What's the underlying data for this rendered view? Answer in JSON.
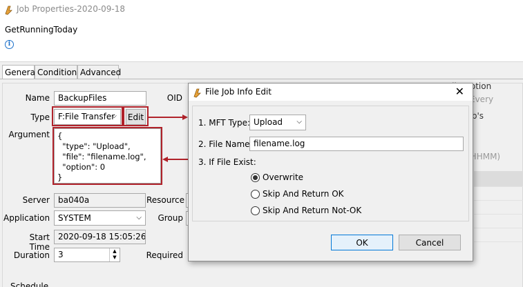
{
  "window": {
    "title": "Job Properties-2020-09-18",
    "job_name": "GetRunningToday",
    "info_icon": "info-icon"
  },
  "tabs": [
    {
      "label": "General",
      "active": true
    },
    {
      "label": "Condition",
      "active": false
    },
    {
      "label": "Advanced",
      "active": false
    }
  ],
  "form": {
    "name_label": "Name",
    "name_value": "BackupFiles",
    "oid_label": "OID",
    "type_label": "Type",
    "type_value": "F:File Transfer",
    "edit_button": "Edit",
    "argument_label": "Argument",
    "argument_value": "{\n  \"type\": \"Upload\",\n  \"file\": \"filename.log\",\n  \"option\": 0\n}",
    "server_label": "Server",
    "server_value": "ba040a",
    "resource_label": "Resource",
    "application_label": "Application",
    "application_value": "SYSTEM",
    "group_label": "Group",
    "start_time_label": "Start Time",
    "start_time_value": "2020-09-18 15:05:26",
    "duration_label": "Duration",
    "duration_value": "3",
    "required_label": "Required",
    "schedule_label": "Schedule"
  },
  "right_panel": {
    "option_label": "Cyclic Option",
    "every_label": "Every",
    "jobs_label": "Job's",
    "time_format": "(HHMM)"
  },
  "dialog": {
    "title": "File Job Info Edit",
    "mft_type_label": "1. MFT Type:",
    "mft_type_value": "Upload",
    "file_name_label": "2. File Name:",
    "file_name_value": "filename.log",
    "if_exist_label": "3. If File Exist:",
    "options": [
      {
        "label": "Overwrite",
        "selected": true
      },
      {
        "label": "Skip And Return OK",
        "selected": false
      },
      {
        "label": "Skip And Return Not-OK",
        "selected": false
      }
    ],
    "ok_button": "OK",
    "cancel_button": "Cancel"
  },
  "colors": {
    "highlight": "#b0222a",
    "accent": "#1a6fc9"
  }
}
